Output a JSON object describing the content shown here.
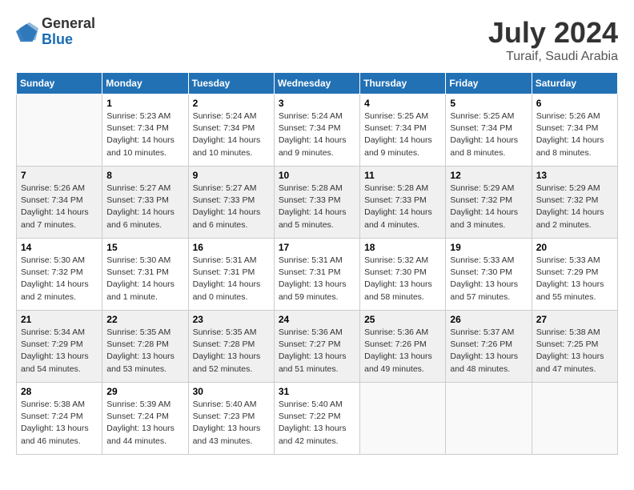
{
  "logo": {
    "general": "General",
    "blue": "Blue"
  },
  "title": {
    "month": "July 2024",
    "location": "Turaif, Saudi Arabia"
  },
  "weekdays": [
    "Sunday",
    "Monday",
    "Tuesday",
    "Wednesday",
    "Thursday",
    "Friday",
    "Saturday"
  ],
  "weeks": [
    [
      {
        "day": "",
        "empty": true
      },
      {
        "day": "1",
        "sunrise": "Sunrise: 5:23 AM",
        "sunset": "Sunset: 7:34 PM",
        "daylight": "Daylight: 14 hours and 10 minutes."
      },
      {
        "day": "2",
        "sunrise": "Sunrise: 5:24 AM",
        "sunset": "Sunset: 7:34 PM",
        "daylight": "Daylight: 14 hours and 10 minutes."
      },
      {
        "day": "3",
        "sunrise": "Sunrise: 5:24 AM",
        "sunset": "Sunset: 7:34 PM",
        "daylight": "Daylight: 14 hours and 9 minutes."
      },
      {
        "day": "4",
        "sunrise": "Sunrise: 5:25 AM",
        "sunset": "Sunset: 7:34 PM",
        "daylight": "Daylight: 14 hours and 9 minutes."
      },
      {
        "day": "5",
        "sunrise": "Sunrise: 5:25 AM",
        "sunset": "Sunset: 7:34 PM",
        "daylight": "Daylight: 14 hours and 8 minutes."
      },
      {
        "day": "6",
        "sunrise": "Sunrise: 5:26 AM",
        "sunset": "Sunset: 7:34 PM",
        "daylight": "Daylight: 14 hours and 8 minutes."
      }
    ],
    [
      {
        "day": "7",
        "sunrise": "Sunrise: 5:26 AM",
        "sunset": "Sunset: 7:34 PM",
        "daylight": "Daylight: 14 hours and 7 minutes."
      },
      {
        "day": "8",
        "sunrise": "Sunrise: 5:27 AM",
        "sunset": "Sunset: 7:33 PM",
        "daylight": "Daylight: 14 hours and 6 minutes."
      },
      {
        "day": "9",
        "sunrise": "Sunrise: 5:27 AM",
        "sunset": "Sunset: 7:33 PM",
        "daylight": "Daylight: 14 hours and 6 minutes."
      },
      {
        "day": "10",
        "sunrise": "Sunrise: 5:28 AM",
        "sunset": "Sunset: 7:33 PM",
        "daylight": "Daylight: 14 hours and 5 minutes."
      },
      {
        "day": "11",
        "sunrise": "Sunrise: 5:28 AM",
        "sunset": "Sunset: 7:33 PM",
        "daylight": "Daylight: 14 hours and 4 minutes."
      },
      {
        "day": "12",
        "sunrise": "Sunrise: 5:29 AM",
        "sunset": "Sunset: 7:32 PM",
        "daylight": "Daylight: 14 hours and 3 minutes."
      },
      {
        "day": "13",
        "sunrise": "Sunrise: 5:29 AM",
        "sunset": "Sunset: 7:32 PM",
        "daylight": "Daylight: 14 hours and 2 minutes."
      }
    ],
    [
      {
        "day": "14",
        "sunrise": "Sunrise: 5:30 AM",
        "sunset": "Sunset: 7:32 PM",
        "daylight": "Daylight: 14 hours and 2 minutes."
      },
      {
        "day": "15",
        "sunrise": "Sunrise: 5:30 AM",
        "sunset": "Sunset: 7:31 PM",
        "daylight": "Daylight: 14 hours and 1 minute."
      },
      {
        "day": "16",
        "sunrise": "Sunrise: 5:31 AM",
        "sunset": "Sunset: 7:31 PM",
        "daylight": "Daylight: 14 hours and 0 minutes."
      },
      {
        "day": "17",
        "sunrise": "Sunrise: 5:31 AM",
        "sunset": "Sunset: 7:31 PM",
        "daylight": "Daylight: 13 hours and 59 minutes."
      },
      {
        "day": "18",
        "sunrise": "Sunrise: 5:32 AM",
        "sunset": "Sunset: 7:30 PM",
        "daylight": "Daylight: 13 hours and 58 minutes."
      },
      {
        "day": "19",
        "sunrise": "Sunrise: 5:33 AM",
        "sunset": "Sunset: 7:30 PM",
        "daylight": "Daylight: 13 hours and 57 minutes."
      },
      {
        "day": "20",
        "sunrise": "Sunrise: 5:33 AM",
        "sunset": "Sunset: 7:29 PM",
        "daylight": "Daylight: 13 hours and 55 minutes."
      }
    ],
    [
      {
        "day": "21",
        "sunrise": "Sunrise: 5:34 AM",
        "sunset": "Sunset: 7:29 PM",
        "daylight": "Daylight: 13 hours and 54 minutes."
      },
      {
        "day": "22",
        "sunrise": "Sunrise: 5:35 AM",
        "sunset": "Sunset: 7:28 PM",
        "daylight": "Daylight: 13 hours and 53 minutes."
      },
      {
        "day": "23",
        "sunrise": "Sunrise: 5:35 AM",
        "sunset": "Sunset: 7:28 PM",
        "daylight": "Daylight: 13 hours and 52 minutes."
      },
      {
        "day": "24",
        "sunrise": "Sunrise: 5:36 AM",
        "sunset": "Sunset: 7:27 PM",
        "daylight": "Daylight: 13 hours and 51 minutes."
      },
      {
        "day": "25",
        "sunrise": "Sunrise: 5:36 AM",
        "sunset": "Sunset: 7:26 PM",
        "daylight": "Daylight: 13 hours and 49 minutes."
      },
      {
        "day": "26",
        "sunrise": "Sunrise: 5:37 AM",
        "sunset": "Sunset: 7:26 PM",
        "daylight": "Daylight: 13 hours and 48 minutes."
      },
      {
        "day": "27",
        "sunrise": "Sunrise: 5:38 AM",
        "sunset": "Sunset: 7:25 PM",
        "daylight": "Daylight: 13 hours and 47 minutes."
      }
    ],
    [
      {
        "day": "28",
        "sunrise": "Sunrise: 5:38 AM",
        "sunset": "Sunset: 7:24 PM",
        "daylight": "Daylight: 13 hours and 46 minutes."
      },
      {
        "day": "29",
        "sunrise": "Sunrise: 5:39 AM",
        "sunset": "Sunset: 7:24 PM",
        "daylight": "Daylight: 13 hours and 44 minutes."
      },
      {
        "day": "30",
        "sunrise": "Sunrise: 5:40 AM",
        "sunset": "Sunset: 7:23 PM",
        "daylight": "Daylight: 13 hours and 43 minutes."
      },
      {
        "day": "31",
        "sunrise": "Sunrise: 5:40 AM",
        "sunset": "Sunset: 7:22 PM",
        "daylight": "Daylight: 13 hours and 42 minutes."
      },
      {
        "day": "",
        "empty": true
      },
      {
        "day": "",
        "empty": true
      },
      {
        "day": "",
        "empty": true
      }
    ]
  ]
}
